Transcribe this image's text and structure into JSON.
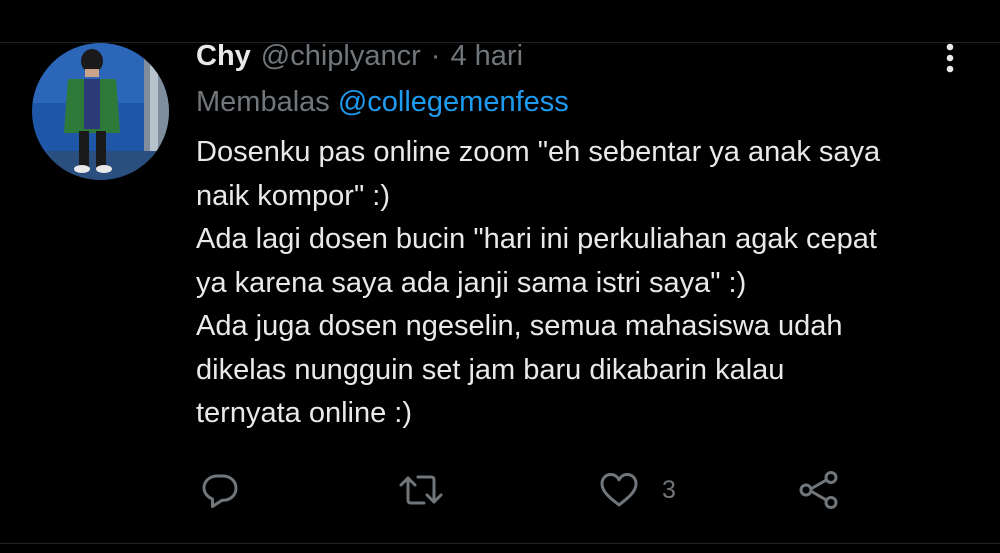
{
  "tweet": {
    "author_name": "Chy",
    "author_handle": "@chiplyancr",
    "separator": "·",
    "timestamp": "4 hari",
    "reply_prefix": "Membalas",
    "reply_to": "@collegemenfess",
    "text_lines": [
      "Dosenku pas online zoom \"eh sebentar ya anak saya",
      "naik kompor\" :)",
      "Ada lagi dosen bucin \"hari ini perkuliahan agak cepat",
      "ya karena saya ada janji sama istri saya\" :)",
      "Ada juga dosen ngeselin, semua mahasiswa udah",
      "dikelas nungguin set jam baru dikabarin kalau",
      "ternyata online :)"
    ]
  },
  "actions": {
    "reply_icon": "reply-icon",
    "retweet_icon": "retweet-icon",
    "like_icon": "heart-icon",
    "like_count": "3",
    "share_icon": "share-icon"
  },
  "colors": {
    "background": "#000000",
    "text_primary": "#e7e9ea",
    "text_secondary": "#71767b",
    "accent": "#1d9bf0"
  }
}
